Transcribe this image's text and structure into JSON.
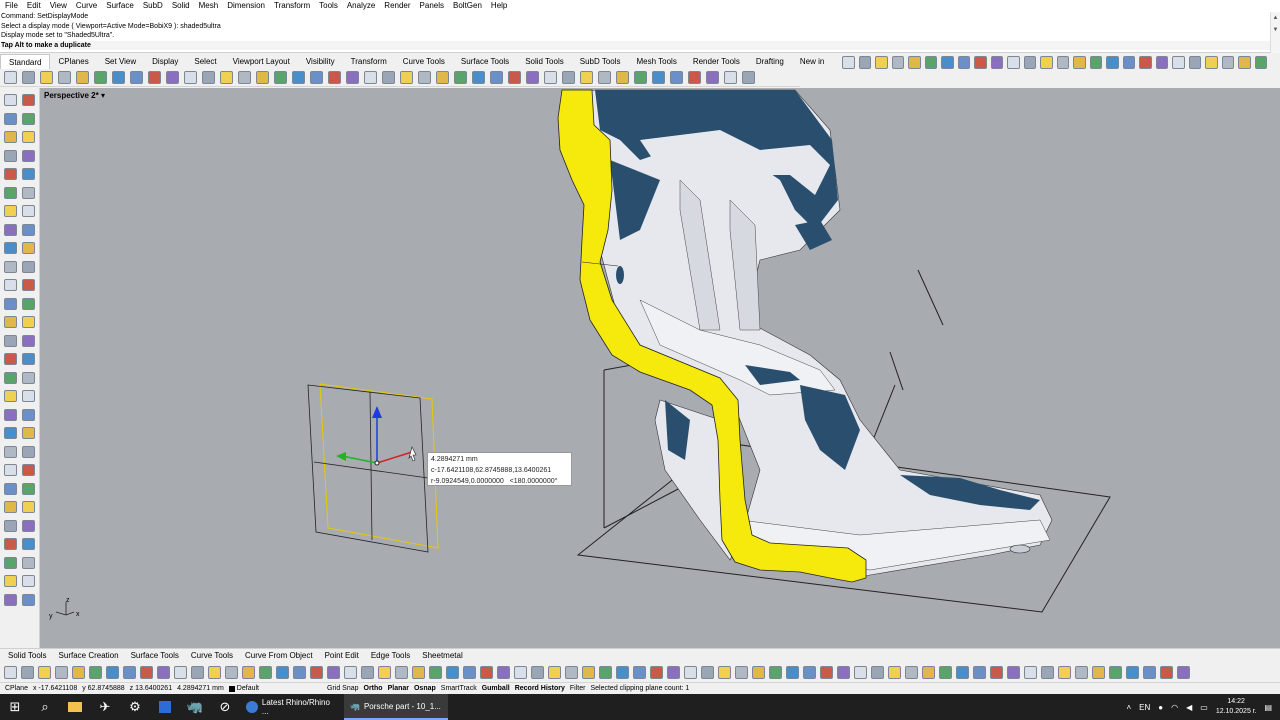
{
  "menu": [
    "File",
    "Edit",
    "View",
    "Curve",
    "Surface",
    "SubD",
    "Solid",
    "Mesh",
    "Dimension",
    "Transform",
    "Tools",
    "Analyze",
    "Render",
    "Panels",
    "BoltGen",
    "Help"
  ],
  "command_history": [
    "Command: SetDisplayMode",
    "Select a display mode ( Viewport=Active  Mode=BobiX9 ): shaded5ultra",
    "Display mode set to \"Shaded5Ultra\"."
  ],
  "command_prompt": "Tap Alt to make a duplicate",
  "ribbon_tabs": [
    "Standard",
    "CPlanes",
    "Set View",
    "Display",
    "Select",
    "Viewport Layout",
    "Visibility",
    "Transform",
    "Curve Tools",
    "Surface Tools",
    "Solid Tools",
    "SubD Tools",
    "Mesh Tools",
    "Render Tools",
    "Drafting",
    "New in"
  ],
  "active_tab": "Standard",
  "viewport": {
    "label": "Perspective 2*",
    "axis_x": "x",
    "axis_y": "y",
    "axis_z": "z"
  },
  "tooltip": {
    "distance": "4.2894271 mm",
    "cartesian": "c-17.6421108,62.8745888,13.6400261",
    "polar_r": "r-9.0924549,0.0000000",
    "angle": "<180.0000000°"
  },
  "bottom_tabs": [
    "Solid Tools",
    "Surface Creation",
    "Surface Tools",
    "Curve Tools",
    "Curve From Object",
    "Point Edit",
    "Edge Tools",
    "Sheetmetal"
  ],
  "status": {
    "cplane": "CPlane",
    "x": "x -17.6421108",
    "y": "y 62.8745888",
    "z": "z 13.6400261",
    "distance": "4.2894271 mm",
    "layer": "Default",
    "grid_snap": "Grid Snap",
    "ortho": "Ortho",
    "planar": "Planar",
    "osnap": "Osnap",
    "smarttrack": "SmartTrack",
    "gumball": "Gumball",
    "record_history": "Record History",
    "filter": "Filter",
    "message": "Selected clipping plane count: 1"
  },
  "taskbar": {
    "apps": [
      {
        "label": "Latest Rhino/Rhino ..."
      },
      {
        "label": "Porsche part - 10_1..."
      }
    ],
    "lang": "EN",
    "time": "14:22",
    "date": "12.10.2025 г."
  },
  "colors": {
    "viewport_bg": "#a8abb0",
    "section_fill": "#f5ea0c",
    "part_blue": "#2a4f6e",
    "part_white": "#e6e8ee",
    "taskbar": "#1f1f1f"
  }
}
